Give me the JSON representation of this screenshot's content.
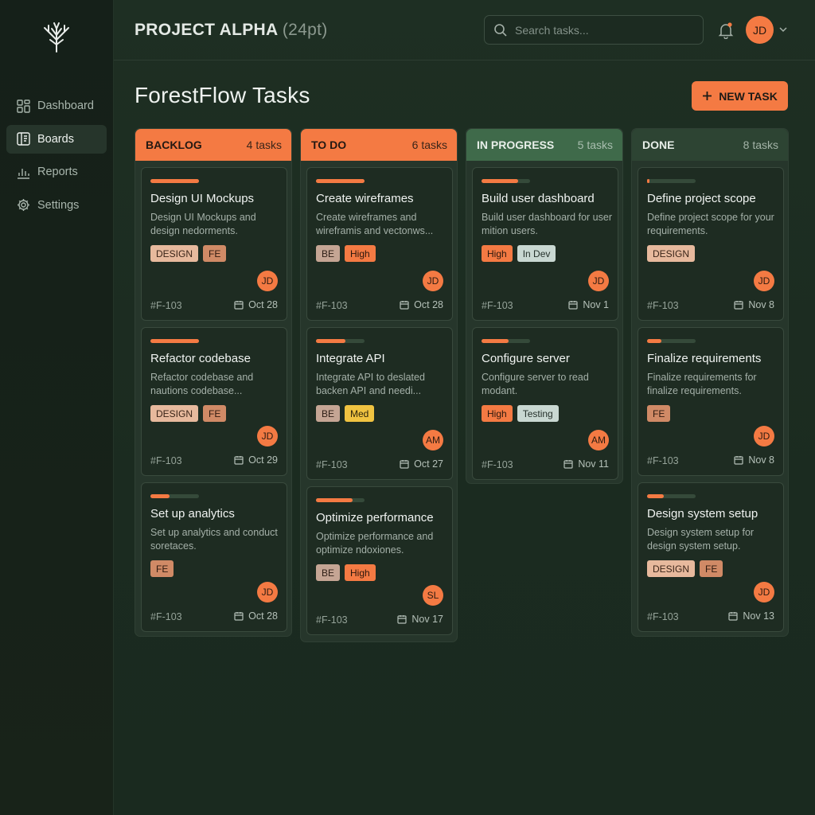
{
  "sidebar": {
    "logo_icon": "tree-icon",
    "items": [
      {
        "label": "Dashboard",
        "icon": "grid-icon"
      },
      {
        "label": "Boards",
        "icon": "board-icon",
        "active": true
      },
      {
        "label": "Reports",
        "icon": "chart-icon"
      },
      {
        "label": "Settings",
        "icon": "gear-icon"
      }
    ]
  },
  "header": {
    "project_title": "PROJECT ALPHA",
    "project_title_suffix": "(24pt)",
    "search_placeholder": "Search tasks...",
    "user_initials": "JD"
  },
  "page": {
    "title": "ForestFlow Tasks",
    "new_task_label": "NEW TASK"
  },
  "colors": {
    "accent": "#f47a43",
    "background": "#1b2b20",
    "card": "#1e2c22"
  },
  "columns": [
    {
      "name": "BACKLOG",
      "count": "4 tasks",
      "cards": [
        {
          "title": "Design UI Mockups",
          "desc": "Design UI Mockups and design nedorments.",
          "tags": [
            "DESIGN",
            "FE"
          ],
          "assignee": "JD",
          "id": "#F-103",
          "date": "Oct 28",
          "progress": 1.0
        },
        {
          "title": "Refactor codebase",
          "desc": "Refactor codebase and nautions codebase...",
          "tags": [
            "DESIGN",
            "FE"
          ],
          "assignee": "JD",
          "id": "#F-103",
          "date": "Oct 29",
          "progress": 1.0
        },
        {
          "title": "Set up analytics",
          "desc": "Set up analytics and conduct  soretaces.",
          "tags": [
            "FE"
          ],
          "assignee": "JD",
          "id": "#F-103",
          "date": "Oct 28",
          "progress": 0.4
        }
      ]
    },
    {
      "name": "TO DO",
      "count": "6 tasks",
      "cards": [
        {
          "title": "Create wireframes",
          "desc": "Create wireframes and wireframis and vectonws...",
          "tags": [
            "BE",
            "High"
          ],
          "assignee": "JD",
          "id": "#F-103",
          "date": "Oct 28",
          "progress": 1.0
        },
        {
          "title": "Integrate API",
          "desc": "Integrate API to deslated backen API and needi...",
          "tags": [
            "BE",
            "Med"
          ],
          "assignee": "AM",
          "id": "#F-103",
          "date": "Oct 27",
          "progress": 0.6
        },
        {
          "title": "Optimize performance",
          "desc": "Optimize performance and optimize ndoxiones.",
          "tags": [
            "BE",
            "High"
          ],
          "assignee": "SL",
          "id": "#F-103",
          "date": "Nov 17",
          "progress": 0.75
        }
      ]
    },
    {
      "name": "IN PROGRESS",
      "count": "5 tasks",
      "cards": [
        {
          "title": "Build user dashboard",
          "desc": "Build user dashboard for user mition users.",
          "tags": [
            "High",
            "In Dev"
          ],
          "assignee": "JD",
          "id": "#F-103",
          "date": "Nov 1",
          "progress": 0.75
        },
        {
          "title": "Configure server",
          "desc": "Configure server to read modant.",
          "tags": [
            "High",
            "Testing"
          ],
          "assignee": "AM",
          "id": "#F-103",
          "date": "Nov 11",
          "progress": 0.55
        }
      ]
    },
    {
      "name": "DONE",
      "count": "8 tasks",
      "cards": [
        {
          "title": "Define project scope",
          "desc": "Define project scope for your requirements.",
          "tags": [
            "DESIGN"
          ],
          "assignee": "JD",
          "id": "#F-103",
          "date": "Nov 8",
          "progress": 0.05
        },
        {
          "title": "Finalize requirements",
          "desc": "Finalize requirements for finalize requirements.",
          "tags": [
            "FE"
          ],
          "assignee": "JD",
          "id": "#F-103",
          "date": "Nov 8",
          "progress": 0.3
        },
        {
          "title": "Design system setup",
          "desc": "Design system setup for design system setup.",
          "tags": [
            "DESIGN",
            "FE"
          ],
          "assignee": "JD",
          "id": "#F-103",
          "date": "Nov 13",
          "progress": 0.35
        }
      ]
    }
  ]
}
